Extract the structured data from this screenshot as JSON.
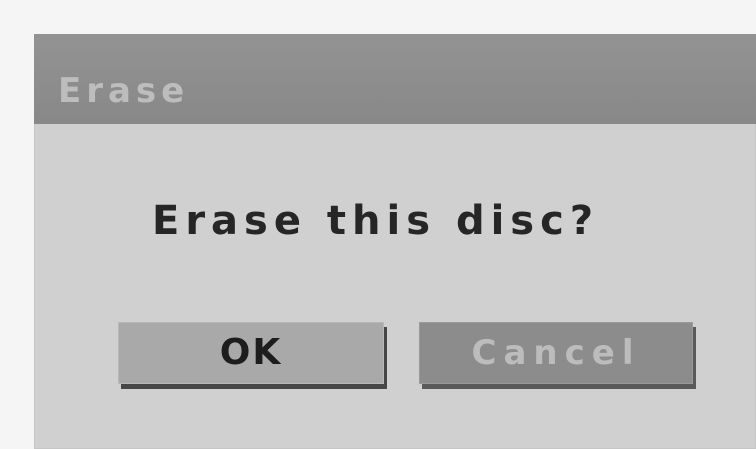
{
  "dialog": {
    "title": "Erase",
    "message": "Erase this disc?",
    "buttons": {
      "ok_label": "OK",
      "cancel_label": "Cancel"
    }
  },
  "colors": {
    "titlebar": "#8e8e8e",
    "dialog_body": "#d0d0d0",
    "ok_button": "#a9a9a9",
    "cancel_button": "#8c8c8c",
    "message_text": "#262626"
  }
}
